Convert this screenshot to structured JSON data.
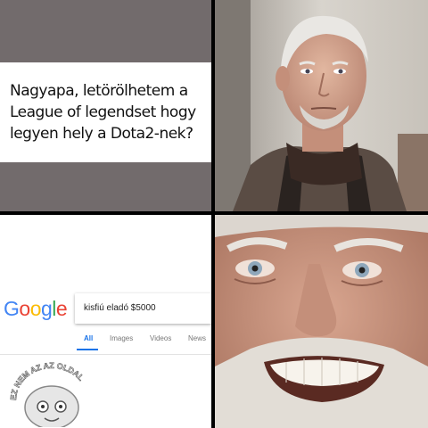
{
  "panels": {
    "top_left": {
      "question": "Nagyapa, letörölhetem a League of legendset hogy legyen hely a Dota2-nek?"
    },
    "bottom_left": {
      "logo_letters": [
        "G",
        "o",
        "o",
        "g",
        "l",
        "e"
      ],
      "logo_colors": [
        "#4285F4",
        "#EA4335",
        "#FBBC05",
        "#4285F4",
        "#34A853",
        "#EA4335"
      ],
      "search_query": "kisfiú eladó $5000",
      "tabs": [
        "All",
        "Images",
        "Videos",
        "News"
      ],
      "active_tab": "All",
      "watermark_text": "EZ NEM AZ AZ OLDAL"
    }
  }
}
